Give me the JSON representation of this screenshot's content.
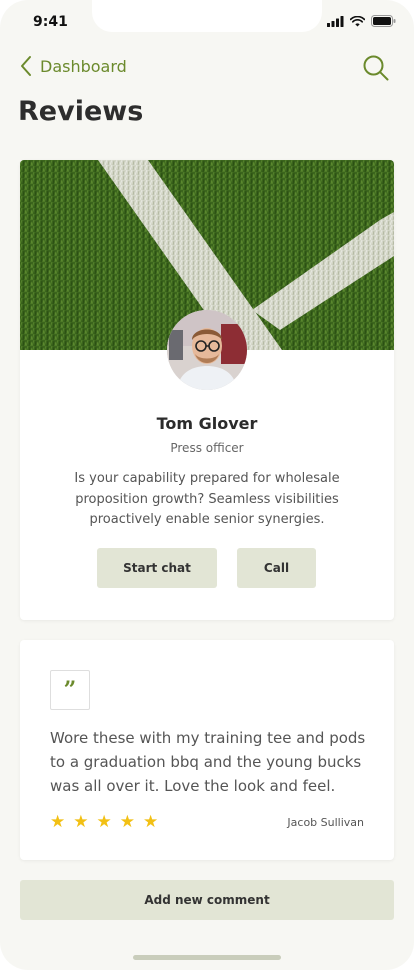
{
  "status_bar": {
    "time": "9:41",
    "icons": [
      "signal-icon",
      "wifi-icon",
      "battery-icon"
    ]
  },
  "nav": {
    "back_label": "Dashboard",
    "back_icon": "chevron-left-icon",
    "search_icon": "search-icon"
  },
  "page": {
    "title": "Reviews"
  },
  "profile": {
    "name": "Tom Glover",
    "role": "Press officer",
    "bio": "Is your capability prepared for wholesale proposition growth? Seamless visibilities proactively enable senior synergies.",
    "start_chat_label": "Start chat",
    "call_label": "Call"
  },
  "review": {
    "quote_icon": "quote-icon",
    "quote_glyph": "”",
    "text": "Wore these with my training tee and pods to a graduation bbq and the young bucks was all over it. Love the look and feel.",
    "rating": 5,
    "rating_max": 5,
    "reviewer": "Jacob Sullivan"
  },
  "add_comment_label": "Add new comment",
  "colors": {
    "accent": "#6b8a2c",
    "button_bg": "#e2e5d5",
    "star": "#f2c014",
    "background": "#f7f7f3"
  }
}
